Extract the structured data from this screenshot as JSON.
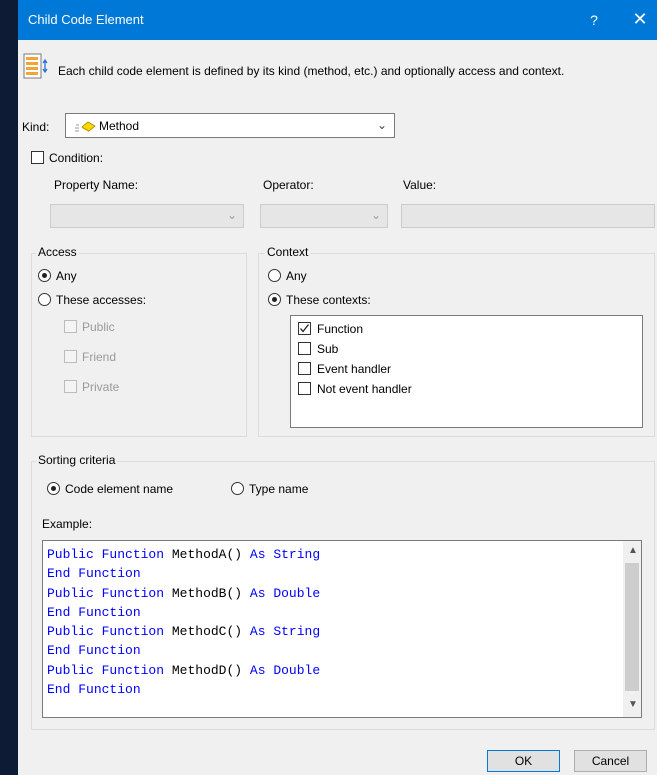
{
  "window": {
    "title": "Child Code Element",
    "help_label": "?",
    "close_label": "✕"
  },
  "header": {
    "description": "Each child code element is defined by its kind (method, etc.) and optionally access and context.",
    "icon": "document-sort-icon"
  },
  "kind": {
    "label": "Kind:",
    "value": "Method",
    "icon": "method-icon"
  },
  "condition": {
    "label": "Condition:",
    "checked": false,
    "property_name_label": "Property Name:",
    "operator_label": "Operator:",
    "value_label": "Value:",
    "property_name_value": "",
    "operator_value": "",
    "value_value": ""
  },
  "access": {
    "title": "Access",
    "any_label": "Any",
    "these_label": "These accesses:",
    "selected": "any",
    "options": [
      {
        "label": "Public",
        "checked": false
      },
      {
        "label": "Friend",
        "checked": false
      },
      {
        "label": "Private",
        "checked": false
      }
    ]
  },
  "context": {
    "title": "Context",
    "any_label": "Any",
    "these_label": "These contexts:",
    "selected": "these",
    "options": [
      {
        "label": "Function",
        "checked": true
      },
      {
        "label": "Sub",
        "checked": false
      },
      {
        "label": "Event handler",
        "checked": false
      },
      {
        "label": "Not event handler",
        "checked": false
      }
    ]
  },
  "sorting": {
    "title": "Sorting criteria",
    "code_element_label": "Code element name",
    "type_name_label": "Type name",
    "selected": "code_element",
    "example_label": "Example:",
    "lines": [
      "Public Function MethodA() As String",
      "End Function",
      "Public Function MethodB() As Double",
      "End Function",
      "Public Function MethodC() As String",
      "End Function",
      "Public Function MethodD() As Double",
      "End Function"
    ]
  },
  "buttons": {
    "ok": "OK",
    "cancel": "Cancel"
  },
  "colors": {
    "titlebar": "#0078d7",
    "keyword": "#0000ff",
    "background": "#f0f0f0"
  }
}
